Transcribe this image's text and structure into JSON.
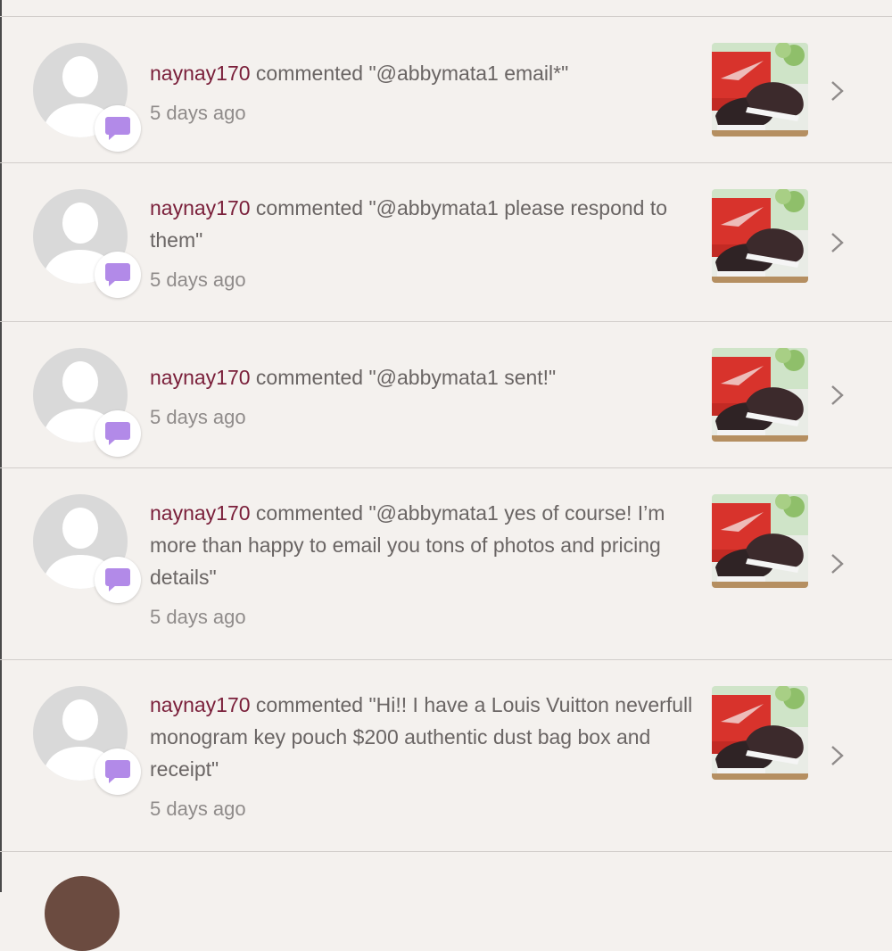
{
  "notifications": [
    {
      "user": "naynay170",
      "message": " commented \"@abbymata1 email*\"",
      "time": "5 days ago"
    },
    {
      "user": "naynay170",
      "message": " commented \"@abbymata1 please respond to them\"",
      "time": "5 days ago"
    },
    {
      "user": "naynay170",
      "message": " commented \"@abbymata1 sent!\"",
      "time": "5 days ago"
    },
    {
      "user": "naynay170",
      "message": " commented \"@abbymata1 yes of course! I’m more than happy to email you tons of photos and pricing details\"",
      "time": "5 days ago"
    },
    {
      "user": "naynay170",
      "message": " commented \"Hi!! I have a Louis Vuitton neverfull monogram key pouch $200 authentic dust bag box and receipt\"",
      "time": "5 days ago"
    }
  ],
  "icons": {
    "avatar": "default-avatar-icon",
    "badge": "comment-bubble-icon",
    "chevron": "chevron-right-icon"
  },
  "colors": {
    "background": "#f4f1ee",
    "username": "#7a1f3a",
    "text": "#6a6564",
    "timestamp": "#8f8b8a",
    "comment_badge": "#b28ae8"
  }
}
